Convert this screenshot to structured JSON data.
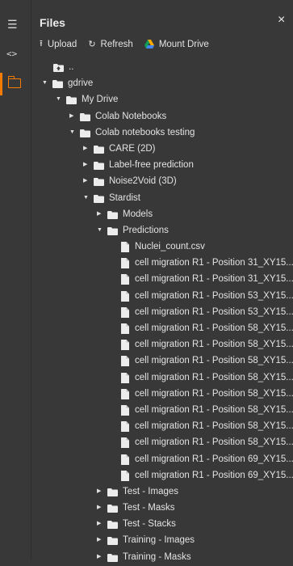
{
  "sidebar": {
    "menu_icon": "menu-icon",
    "code_icon": "code-icon",
    "files_icon": "folder-icon",
    "accent": "#f57c00"
  },
  "panel": {
    "title": "Files",
    "close": "×"
  },
  "toolbar": {
    "upload_label": "Upload",
    "refresh_label": "Refresh",
    "mount_label": "Mount Drive"
  },
  "tree": {
    "up_label": "..",
    "gdrive": "gdrive",
    "my_drive": "My Drive",
    "colab_notebooks": "Colab Notebooks",
    "colab_testing": "Colab notebooks testing",
    "care": "CARE (2D)",
    "label_free": "Label-free prediction",
    "noise2void": "Noise2Void (3D)",
    "stardist": "Stardist",
    "models": "Models",
    "predictions": "Predictions",
    "files": [
      "Nuclei_count.csv",
      "cell migration R1 - Position 31_XY15...",
      "cell migration R1 - Position 31_XY15...",
      "cell migration R1 - Position 53_XY15...",
      "cell migration R1 - Position 53_XY15...",
      "cell migration R1 - Position 58_XY15...",
      "cell migration R1 - Position 58_XY15...",
      "cell migration R1 - Position 58_XY15...",
      "cell migration R1 - Position 58_XY15...",
      "cell migration R1 - Position 58_XY15...",
      "cell migration R1 - Position 58_XY15...",
      "cell migration R1 - Position 58_XY15...",
      "cell migration R1 - Position 58_XY15...",
      "cell migration R1 - Position 69_XY15...",
      "cell migration R1 - Position 69_XY15..."
    ],
    "test_images": "Test - Images",
    "test_masks": "Test - Masks",
    "test_stacks": "Test - Stacks",
    "training_images": "Training - Images",
    "training_masks": "Training - Masks"
  }
}
